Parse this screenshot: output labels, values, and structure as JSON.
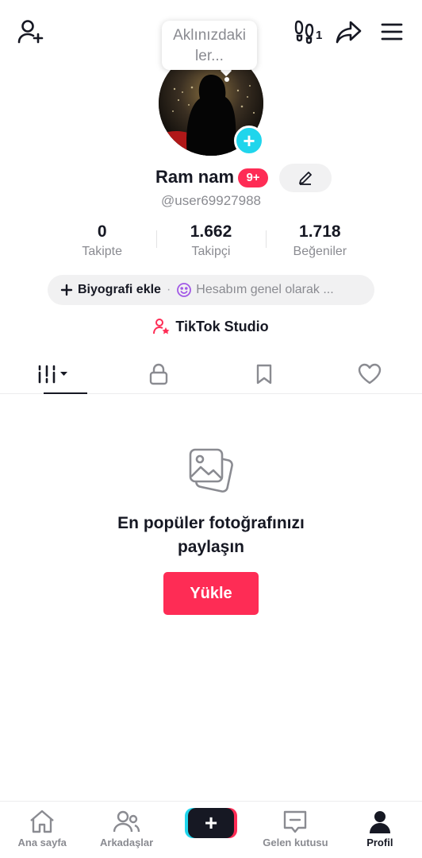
{
  "header": {
    "tooltip": "Aklınızdaki ler...",
    "tooltip_line1": "Aklınızdaki",
    "tooltip_line2": "ler...",
    "footprint_count": "1"
  },
  "profile": {
    "name": "Ram nam",
    "badge": "9+",
    "handle": "@user69927988"
  },
  "stats": [
    {
      "value": "0",
      "label": "Takipte"
    },
    {
      "value": "1.662",
      "label": "Takipçi"
    },
    {
      "value": "1.718",
      "label": "Beğeniler"
    }
  ],
  "bio": {
    "add_label": "Biyografi ekle",
    "privacy_text": "Hesabım genel olarak ..."
  },
  "studio": {
    "label": "TikTok Studio"
  },
  "empty_state": {
    "title": "En popüler fotoğrafınızı paylaşın",
    "button": "Yükle"
  },
  "bottom_nav": [
    {
      "label": "Ana sayfa",
      "icon": "home-icon"
    },
    {
      "label": "Arkadaşlar",
      "icon": "friends-icon"
    },
    {
      "label": "",
      "icon": "create-icon"
    },
    {
      "label": "Gelen kutusu",
      "icon": "inbox-icon"
    },
    {
      "label": "Profil",
      "icon": "profile-icon"
    }
  ],
  "colors": {
    "accent": "#fe2c55",
    "cyan": "#20d5ec",
    "text": "#161823",
    "muted": "#8a8b91"
  }
}
